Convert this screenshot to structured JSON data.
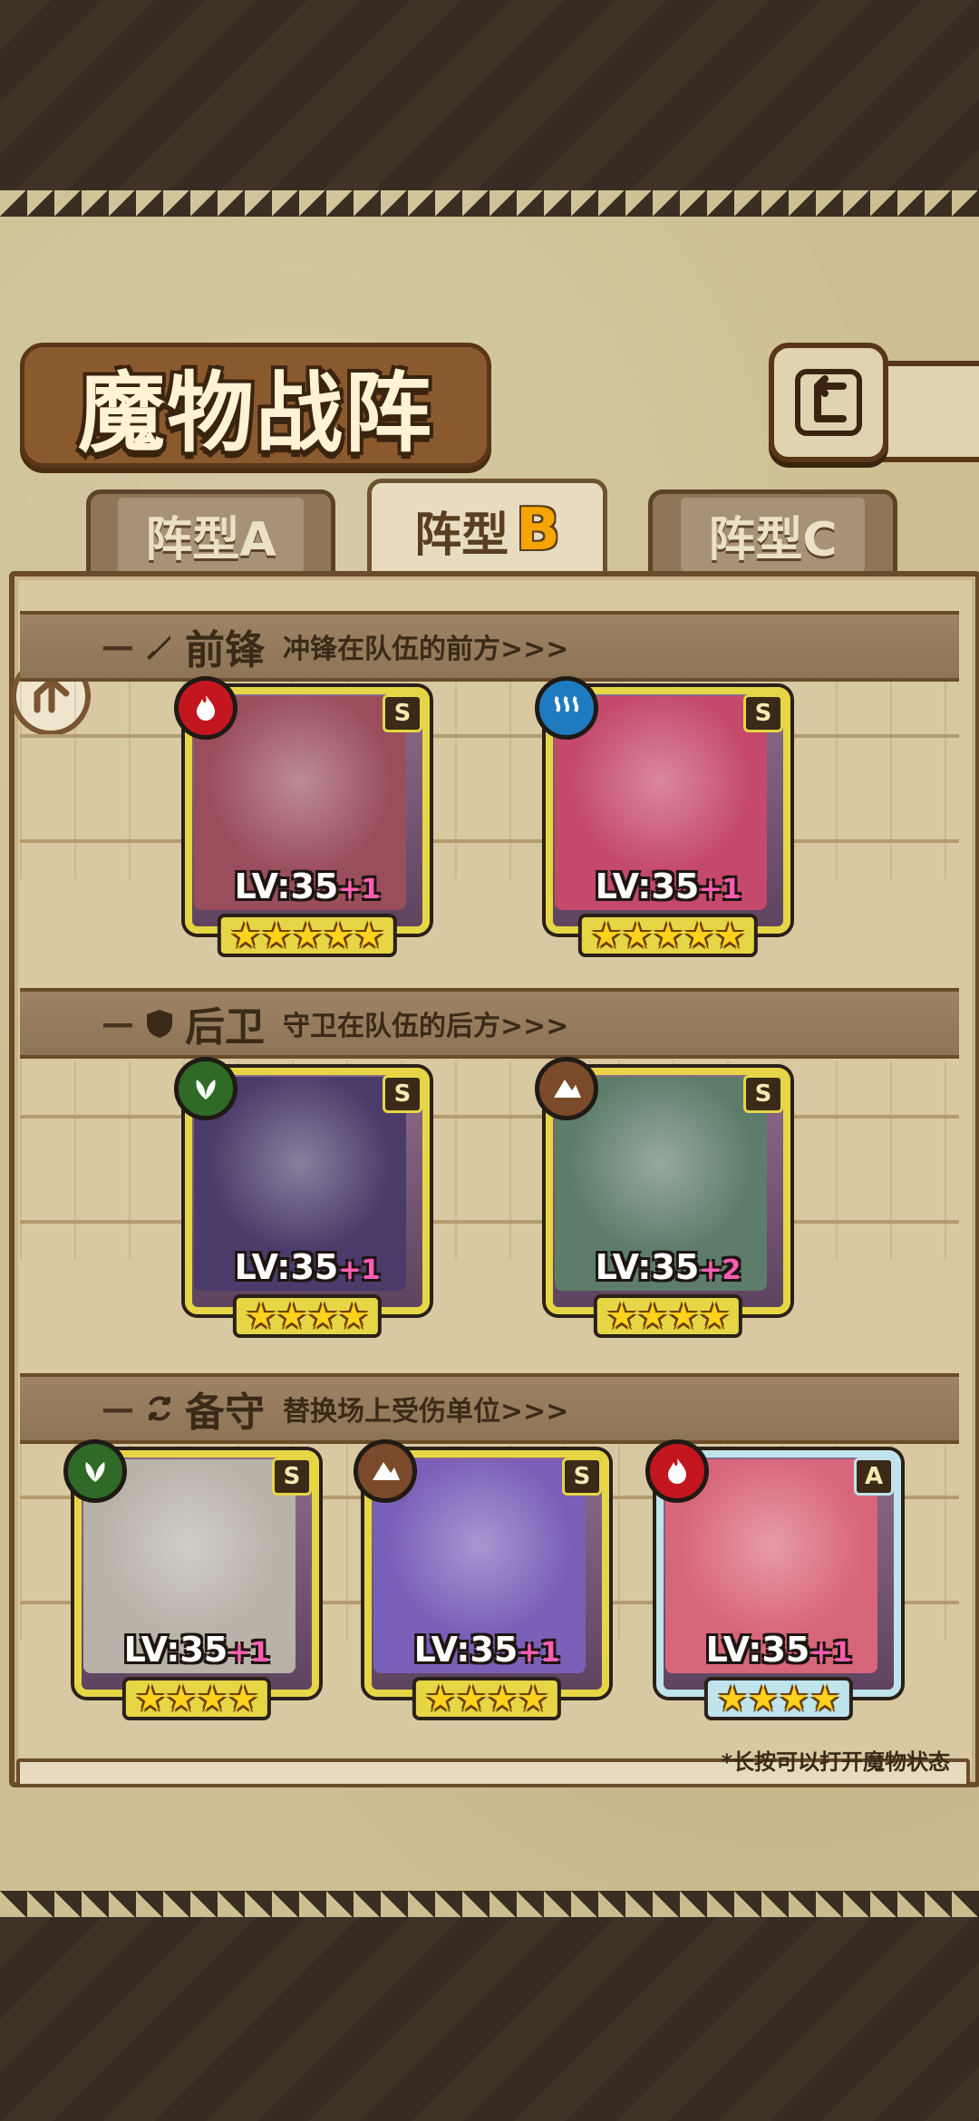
{
  "title": "魔物战阵",
  "tabs": [
    {
      "label": "阵型",
      "letter": "A",
      "active": false
    },
    {
      "label": "阵型",
      "letter": "B",
      "active": true
    },
    {
      "label": "阵型",
      "letter": "C",
      "active": false
    }
  ],
  "sections": {
    "front": {
      "title": "前锋",
      "desc": "冲锋在队伍的前方>>>",
      "icon": "sword-icon"
    },
    "back": {
      "title": "后卫",
      "desc": "守卫在队伍的后方>>>",
      "icon": "shield-icon"
    },
    "reserve": {
      "title": "备守",
      "desc": "替换场上受伤单位>>>",
      "icon": "swap-icon"
    }
  },
  "cards": {
    "front1": {
      "rank": "S",
      "element": "fire",
      "level": "LV:35",
      "plus": "+1",
      "stars": "★★★★★",
      "portrait_color": "#9a4e5c"
    },
    "front2": {
      "rank": "S",
      "element": "water",
      "level": "LV:35",
      "plus": "+1",
      "stars": "★★★★★",
      "portrait_color": "#c4496a"
    },
    "back1": {
      "rank": "S",
      "element": "nature",
      "level": "LV:35",
      "plus": "+1",
      "stars": "★★★★",
      "portrait_color": "#4a3b6a"
    },
    "back2": {
      "rank": "S",
      "element": "earth",
      "level": "LV:35",
      "plus": "+2",
      "stars": "★★★★",
      "portrait_color": "#5d7d6a"
    },
    "res1": {
      "rank": "S",
      "element": "nature",
      "level": "LV:35",
      "plus": "+1",
      "stars": "★★★★",
      "portrait_color": "#b8b2a8"
    },
    "res2": {
      "rank": "S",
      "element": "earth",
      "level": "LV:35",
      "plus": "+1",
      "stars": "★★★★",
      "portrait_color": "#7a5fb8"
    },
    "res3": {
      "rank": "A",
      "element": "fire",
      "level": "LV:35",
      "plus": "+1",
      "stars": "★★★★",
      "portrait_color": "#d8667a"
    }
  },
  "footnote": "*长按可以打开魔物状态",
  "colors": {
    "fire": "#c3161e",
    "water": "#1f7bc0",
    "nature": "#2f6a27",
    "earth": "#7a4a2a",
    "accent": "#f6a400"
  }
}
